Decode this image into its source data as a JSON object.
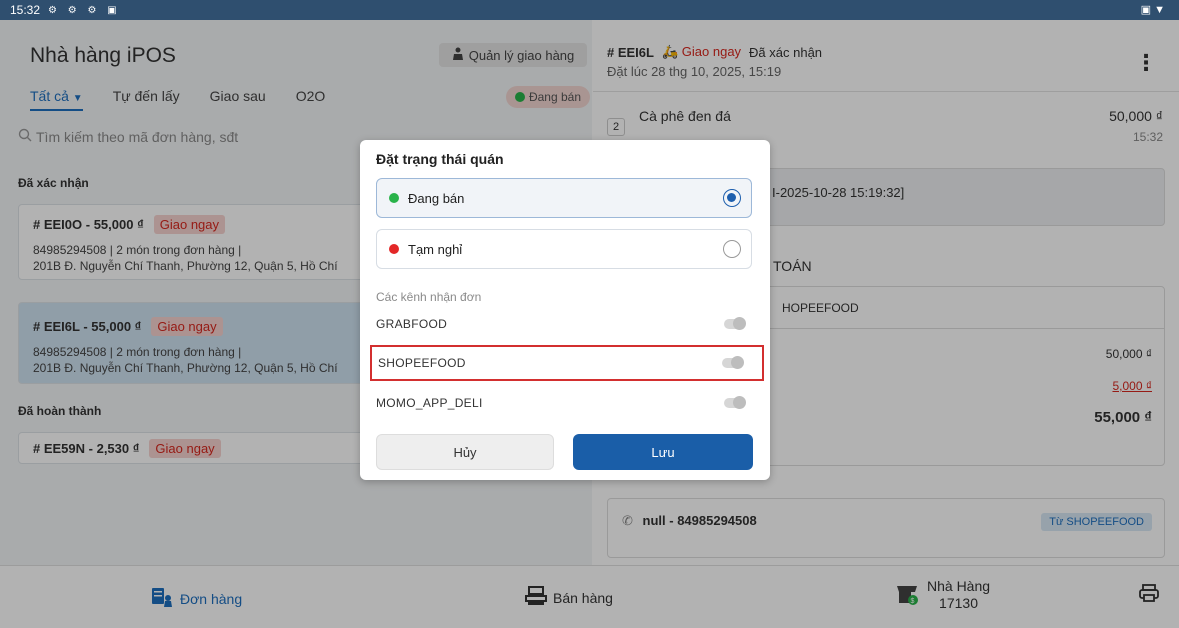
{
  "statusbar": {
    "time": "15:32",
    "icons": "⚙ ⚙ ⚙ ▣",
    "right_icons": "▣ ▼"
  },
  "left": {
    "title": "Nhà hàng iPOS",
    "delivery_manage": "Quản lý giao hàng",
    "tabs": [
      "Tất cả",
      "Tự đến lấy",
      "Giao sau",
      "O2O"
    ],
    "status_pill": "Đang bán",
    "search_placeholder": "Tìm kiếm theo mã đơn hàng, sđt",
    "sections": {
      "confirmed": "Đã xác nhận",
      "completed": "Đã hoàn thành"
    },
    "orders": [
      {
        "code": "# EEI0O - 55,000 ₫",
        "badge": "Giao ngay",
        "line1": "84985294508 | 2 món trong đơn hàng |",
        "line2": "201B Đ. Nguyễn Chí Thanh, Phường 12, Quận 5, Hồ Chí"
      },
      {
        "code": "# EEI6L - 55,000 ₫",
        "badge": "Giao ngay",
        "line1": "84985294508 | 2 món trong đơn hàng |",
        "line2": "201B Đ. Nguyễn Chí Thanh, Phường 12, Quận 5, Hồ Chí"
      },
      {
        "code": "# EE59N - 2,530 ₫",
        "badge": "Giao ngay"
      }
    ]
  },
  "right": {
    "order_code": "# EEI6L",
    "delivery": "Giao ngay",
    "status": "Đã xác nhận",
    "placed_at": "Đặt lúc 28 thg 10, 2025, 15:19",
    "item": {
      "qty": "2",
      "name": "Cà phê đen đá",
      "price": "50,000 ₫",
      "time": "15:32"
    },
    "note": "I-2025-10-28 15:19:32]",
    "payment_title": "TOÁN",
    "payment_source": "HOPEEFOOD",
    "subtotal": "50,000 ₫",
    "fee": "5,000 ₫",
    "total": "55,000 ₫",
    "contact": "null - 84985294508",
    "contact_badge": "Từ SHOPEEFOOD"
  },
  "bottom_nav": {
    "orders": "Đơn hàng",
    "sales": "Bán hàng",
    "store_name": "Nhà Hàng",
    "store_id": "17130"
  },
  "modal": {
    "title": "Đặt trạng thái quán",
    "option_selling": "Đang bán",
    "option_paused": "Tạm nghỉ",
    "channels_label": "Các kênh nhận đơn",
    "channels": [
      "GRABFOOD",
      "SHOPEEFOOD",
      "MOMO_APP_DELI"
    ],
    "cancel": "Hủy",
    "save": "Lưu"
  }
}
